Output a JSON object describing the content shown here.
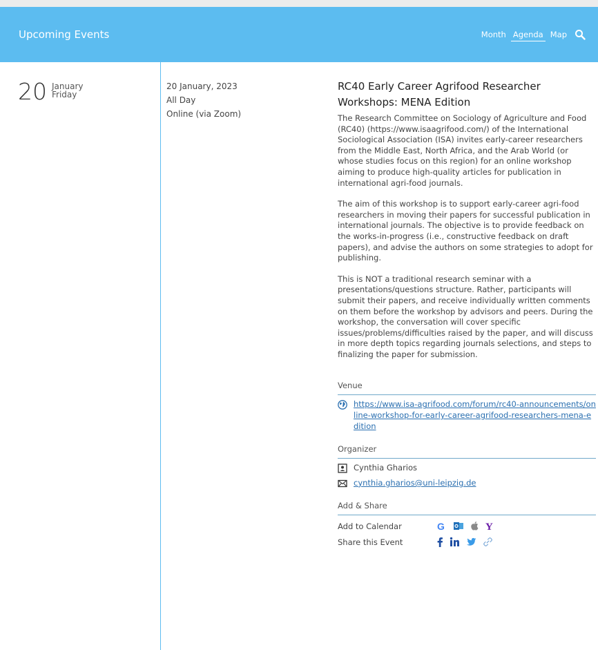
{
  "header": {
    "title": "Upcoming Events",
    "views": [
      {
        "label": "Month"
      },
      {
        "label": "Agenda"
      },
      {
        "label": "Map"
      }
    ],
    "active_view": "Agenda"
  },
  "date": {
    "day": "20",
    "month": "January",
    "weekday": "Friday"
  },
  "info": {
    "full_date": "20 January, 2023",
    "time": "All Day",
    "location": "Online (via Zoom)"
  },
  "event": {
    "title_line1": "RC40 Early Career Agrifood Researcher",
    "title_line2": "Workshops: MENA Edition",
    "paragraphs": [
      "The Research Committee on Sociology of Agriculture and Food (RC40) (https://www.isaagrifood.com/) of the International Sociological Association (ISA) invites early-career researchers from the Middle East, North Africa, and the Arab World (or whose studies focus on this region) for an online workshop aiming to produce high-quality articles for publication in international agri-food journals.",
      "The aim of this workshop is to support early-career agri-food researchers in moving their papers for successful publication in international journals. The objective is to provide feedback on the works-in-progress (i.e., constructive feedback on draft papers), and advise the authors on some strategies to adopt for publishing.",
      "This is NOT a traditional research seminar with a presentations/questions structure. Rather, participants will submit their papers, and receive individually written comments on them before the workshop by advisors and peers. During the workshop, the conversation will cover specific issues/problems/difficulties raised by the paper, and will discuss in more depth topics regarding journals selections, and steps to finalizing the paper for submission."
    ]
  },
  "venue": {
    "label": "Venue",
    "url": "https://www.isa-agrifood.com/forum/rc40-announcements/online-workshop-for-early-career-agrifood-researchers-mena-edition"
  },
  "organizer": {
    "label": "Organizer",
    "name": "Cynthia Gharios",
    "email": "cynthia.gharios@uni-leipzig.de"
  },
  "share": {
    "label": "Add & Share",
    "calendar_label": "Add to Calendar",
    "share_label": "Share this Event",
    "calendar_icons": [
      "google-calendar-icon",
      "outlook-icon",
      "apple-icon",
      "yahoo-icon"
    ],
    "share_icons": [
      "facebook-icon",
      "linkedin-icon",
      "twitter-icon",
      "link-icon"
    ]
  },
  "colors": {
    "header_bg": "#5cbcf0",
    "divider": "#5cbcf0",
    "link": "#2a6fb0"
  }
}
